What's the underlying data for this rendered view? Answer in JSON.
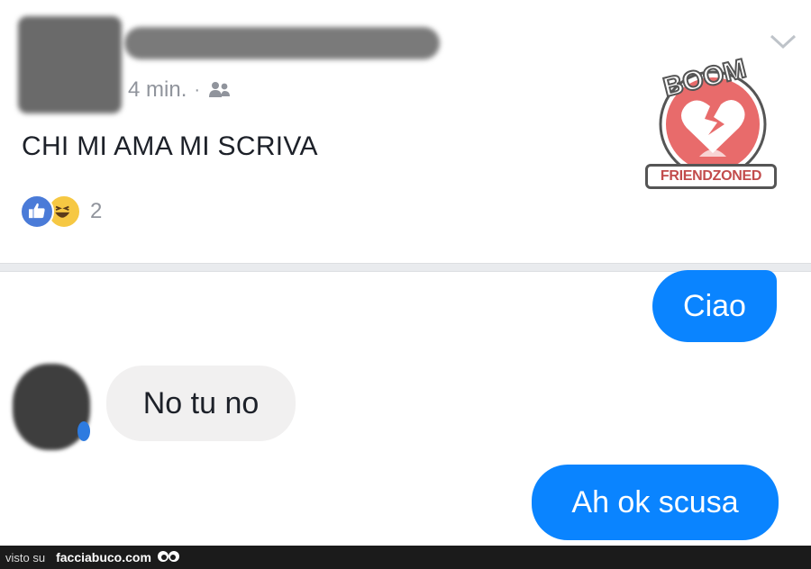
{
  "post": {
    "timestamp": "4 min.",
    "separator_dot": "·",
    "audience_icon": "friends-icon",
    "text": "CHI MI AMA MI SCRIVA",
    "reactions": {
      "icons": [
        "like-icon",
        "haha-icon"
      ],
      "count": "2"
    },
    "menu_icon": "chevron-down-icon"
  },
  "stamp": {
    "top_text": "BOOM",
    "bottom_text": "FRIENDZONED",
    "icon": "broken-heart-icon"
  },
  "chat": {
    "messages": [
      {
        "direction": "sent",
        "text": "Ciao"
      },
      {
        "direction": "received",
        "text": "No tu no"
      },
      {
        "direction": "sent",
        "text": "Ah ok scusa"
      }
    ]
  },
  "footer": {
    "prefix": "visto su",
    "site": "facciabuco.com",
    "logo_icon": "eyes-icon"
  },
  "colors": {
    "sent_bubble": "#0a84ff",
    "received_bubble": "#f1f0f0",
    "meta_text": "#90949c",
    "stamp_red": "#e05a5a"
  }
}
